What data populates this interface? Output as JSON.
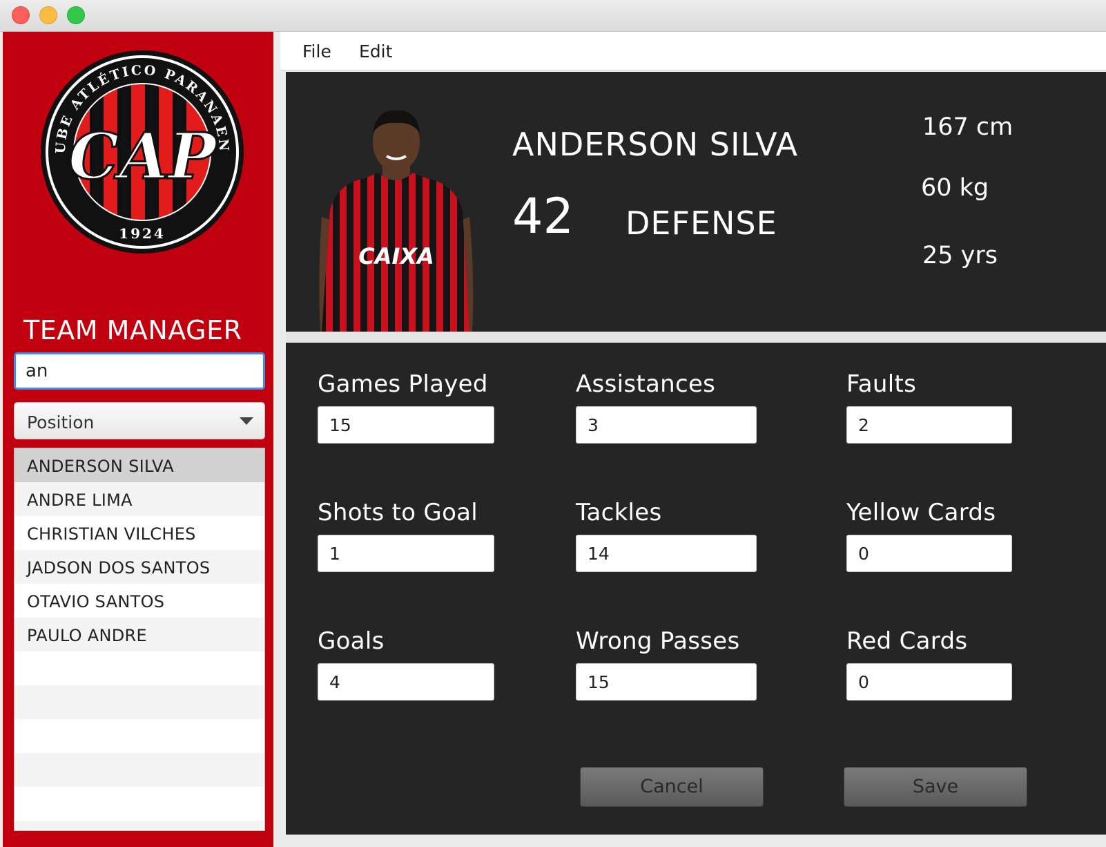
{
  "window": {},
  "sidebar": {
    "logo_text_top": "CLUBE ATLÉTICO PARANAENSE",
    "logo_year": "1924",
    "logo_monogram": "CAP",
    "title": "TEAM MANAGER",
    "search": {
      "value": "an"
    },
    "position_select": {
      "selected": "Position"
    },
    "players": [
      "ANDERSON SILVA",
      "ANDRE LIMA",
      "CHRISTIAN VILCHES",
      "JADSON DOS SANTOS",
      "OTAVIO SANTOS",
      "PAULO ANDRE"
    ]
  },
  "menu": {
    "file": "File",
    "edit": "Edit"
  },
  "player": {
    "name": "ANDERSON SILVA",
    "number": "42",
    "position": "DEFENSE",
    "height": "167 cm",
    "weight": "60 kg",
    "age": "25 yrs",
    "shirt_sponsor": "CAIXA"
  },
  "stats": {
    "games_played": {
      "label": "Games Played",
      "value": "15"
    },
    "assistances": {
      "label": "Assistances",
      "value": "3"
    },
    "faults": {
      "label": "Faults",
      "value": "2"
    },
    "shots_to_goal": {
      "label": "Shots to Goal",
      "value": "1"
    },
    "tackles": {
      "label": "Tackles",
      "value": "14"
    },
    "yellow_cards": {
      "label": "Yellow Cards",
      "value": "0"
    },
    "goals": {
      "label": "Goals",
      "value": "4"
    },
    "wrong_passes": {
      "label": "Wrong Passes",
      "value": "15"
    },
    "red_cards": {
      "label": "Red Cards",
      "value": "0"
    }
  },
  "actions": {
    "cancel": "Cancel",
    "save": "Save"
  },
  "colors": {
    "sidebar": "#c0000f",
    "panel": "#252525",
    "focus": "#3d8ff2"
  }
}
